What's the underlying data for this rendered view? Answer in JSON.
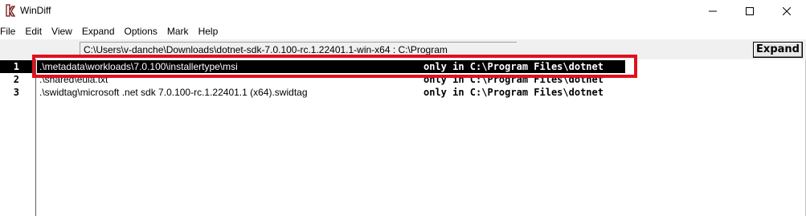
{
  "window": {
    "title": "WinDiff",
    "minimize_glyph": "—",
    "maximize_glyph": "☐",
    "close_glyph": "✕"
  },
  "menu": {
    "items": [
      "File",
      "Edit",
      "View",
      "Expand",
      "Options",
      "Mark",
      "Help"
    ]
  },
  "toolbar": {
    "path_text": "C:\\Users\\v-danche\\Downloads\\dotnet-sdk-7.0.100-rc.1.22401.1-win-x64 : C:\\Program",
    "expand_label": "Expand"
  },
  "rows": [
    {
      "num": "1",
      "path": ".\\metadata\\workloads\\7.0.100\\installertype\\msi",
      "status": "only in C:\\Program Files\\dotnet",
      "selected": true
    },
    {
      "num": "2",
      "path": ".\\shared\\eula.txt",
      "status": "only in C:\\Program Files\\dotnet",
      "selected": false
    },
    {
      "num": "3",
      "path": ".\\swidtag\\microsoft .net sdk 7.0.100-rc.1.22401.1 (x64).swidtag",
      "status": "only in C:\\Program Files\\dotnet",
      "selected": false
    }
  ],
  "colors": {
    "highlight_border": "#e0101e",
    "selection_bg": "#000000",
    "toolbar_bg": "#f0f0f0"
  },
  "icons": {
    "app": "windiff-app-icon",
    "minimize": "minimize-icon",
    "maximize": "maximize-icon",
    "close": "close-icon"
  }
}
